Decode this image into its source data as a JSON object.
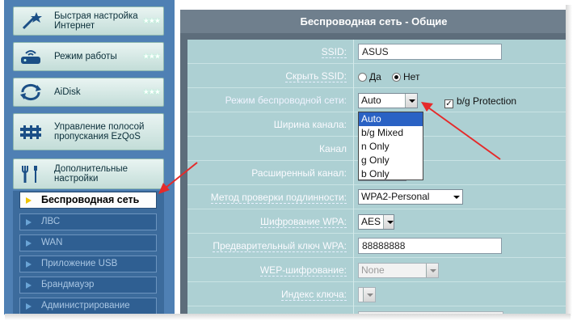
{
  "sidebar": {
    "items": [
      {
        "label": "Быстрая настройка Интернет",
        "icon": "magic-wand-icon"
      },
      {
        "label": "Режим работы",
        "icon": "router-icon"
      },
      {
        "label": "AiDisk",
        "icon": "disk-sync-icon"
      },
      {
        "label": "Управление полосой пропускания EzQoS",
        "icon": "bandwidth-icon"
      },
      {
        "label": "Дополнительные настройки",
        "icon": "tools-icon"
      }
    ],
    "stars": "★★★",
    "subitems": [
      {
        "label": "Беспроводная сеть",
        "active": true
      },
      {
        "label": "ЛВС"
      },
      {
        "label": "WAN"
      },
      {
        "label": "Приложение USB"
      },
      {
        "label": "Брандмауэр"
      },
      {
        "label": "Администрирование"
      }
    ]
  },
  "main": {
    "title": "Беспроводная сеть - Общие",
    "fields": {
      "ssid": {
        "label": "SSID:",
        "value": "ASUS"
      },
      "hide_ssid": {
        "label": "Скрыть SSID:",
        "option_yes": "Да",
        "option_no": "Нет",
        "selected": "Нет"
      },
      "wireless_mode": {
        "label": "Режим беспроводной сети:",
        "value": "Auto",
        "bg_protection": "b/g Protection",
        "bg_checked": true
      },
      "channel_width": {
        "label": "Ширина канала:"
      },
      "channel": {
        "label": "Канал"
      },
      "ext_channel": {
        "label": "Расширенный канал:"
      },
      "auth_method": {
        "label": "Метод проверки подлинности:",
        "value": "WPA2-Personal"
      },
      "wpa_encryption": {
        "label": "Шифрование WPA:",
        "value": "AES"
      },
      "wpa_key": {
        "label": "Предварительный ключ WPA:",
        "value": "88888888"
      },
      "wep_encryption": {
        "label": "WEP-шифрование:",
        "value": "None"
      },
      "key_index": {
        "label": "Индекс ключа:"
      }
    },
    "mode_options": [
      "Auto",
      "b/g Mixed",
      "n Only",
      "g Only",
      "b Only"
    ],
    "mode_selected": "Auto"
  },
  "colors": {
    "sidebar_bg": "#4f80b4",
    "main_body_bg": "#add0d3",
    "title_bar_bg": "#6f7f8d",
    "arrow_red": "#e52a2a",
    "dropdown_selected": "#2a62c4"
  }
}
